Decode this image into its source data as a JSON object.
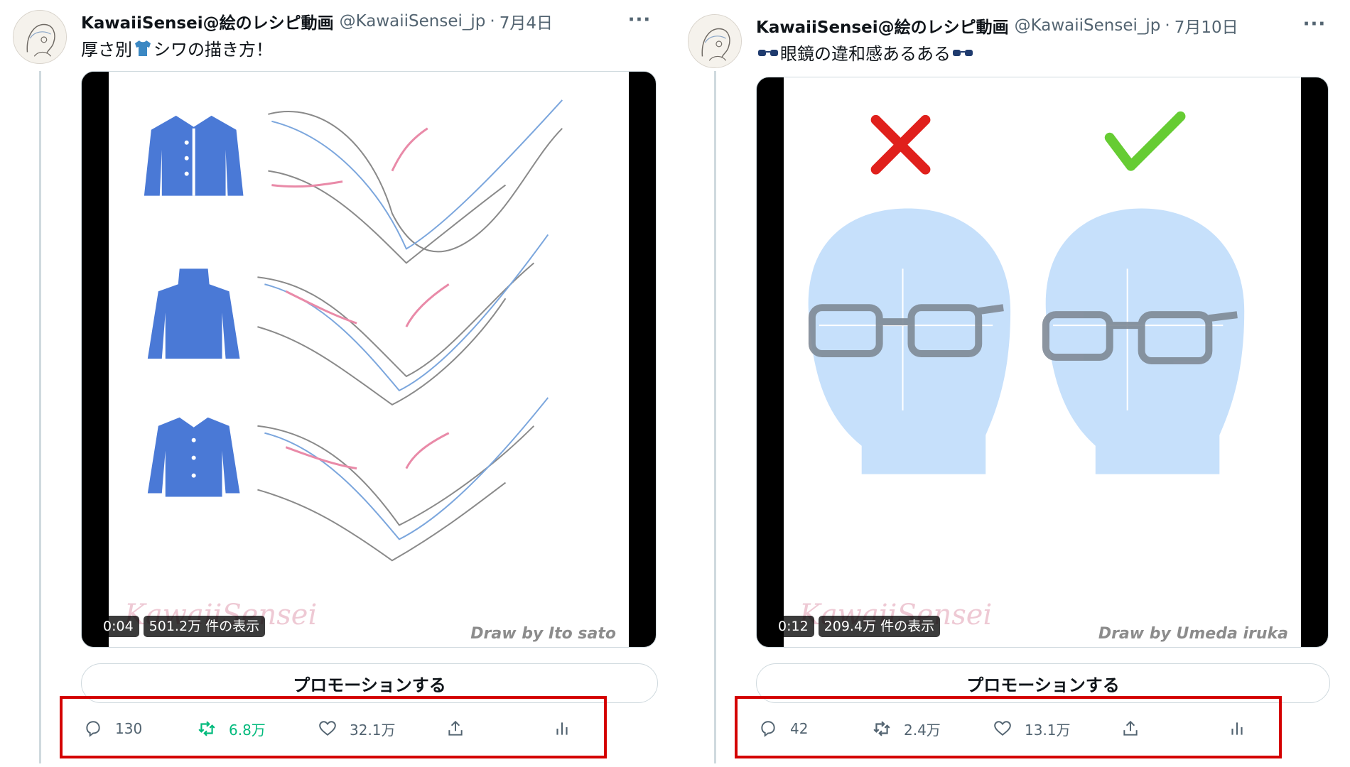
{
  "tweets": [
    {
      "author": {
        "display_name": "KawaiiSensei@絵のレシピ動画",
        "handle": "@KawaiiSensei_jp"
      },
      "date": "7月4日",
      "text_before": "厚さ別",
      "text_after": "シワの描き方！",
      "media": {
        "time": "0:04",
        "views": "501.2万 件の表示",
        "credit": "Draw by  Ito sato",
        "watermark": "KawaiiSensei"
      },
      "promote_label": "プロモーションする",
      "actions": {
        "reply_count": "130",
        "retweet_count": "6.8万",
        "retweet_active": true,
        "like_count": "32.1万"
      }
    },
    {
      "author": {
        "display_name": "KawaiiSensei@絵のレシピ動画",
        "handle": "@KawaiiSensei_jp"
      },
      "date": "7月10日",
      "text_main": "眼鏡の違和感あるある",
      "media": {
        "time": "0:12",
        "views": "209.4万 件の表示",
        "credit": "Draw by Umeda iruka",
        "watermark": "KawaiiSensei"
      },
      "promote_label": "プロモーションする",
      "actions": {
        "reply_count": "42",
        "retweet_count": "2.4万",
        "retweet_active": false,
        "like_count": "13.1万"
      }
    }
  ],
  "icons": {
    "more": "more-icon",
    "reply": "reply-icon",
    "retweet": "retweet-icon",
    "like": "heart-icon",
    "share": "share-icon",
    "analytics": "analytics-icon"
  },
  "colors": {
    "accent_retweet": "#00ba7c",
    "muted": "#536471",
    "highlight_box": "#d40000",
    "shirt_blue": "#4a79d6",
    "head_blue": "#c6e0fb",
    "cross_red": "#e0201c",
    "check_green": "#66cc33"
  }
}
